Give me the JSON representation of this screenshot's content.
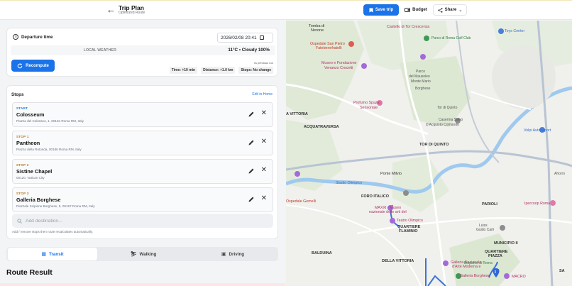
{
  "header": {
    "title": "Trip Plan",
    "subtitle": "Optimized Route",
    "save_label": "Save trip",
    "budget_label": "Budget",
    "share_label": "Share"
  },
  "departure": {
    "label": "Departure time",
    "value": "2026/02/08 20:41"
  },
  "weather": {
    "label": "LOCAL WEATHER",
    "value": "11°C • Cloudy 100%"
  },
  "recompute": {
    "label": "Recompute",
    "vs_label": "vs previous run",
    "chips": [
      "Time: +10 min",
      "Distance: +1.0 km",
      "Stops: No change"
    ]
  },
  "stops": {
    "title": "Stops",
    "edit_link": "Edit in Home",
    "items": [
      {
        "tag": "START",
        "name": "Colosseum",
        "address": "Piazza del Colosseo, 1, 00184 Roma RM, Italy"
      },
      {
        "tag": "STOP 1",
        "name": "Pantheon",
        "address": "Piazza della Rotonda, 00186 Roma RM, Italy"
      },
      {
        "tag": "STOP 2",
        "name": "Sistine Chapel",
        "address": "00120, Vatican City"
      },
      {
        "tag": "STOP 3",
        "name": "Galleria Borghese",
        "address": "Piazzale Scipione Borghese, 5, 00197 Roma RM, Italy"
      }
    ],
    "add_placeholder": "Add destination...",
    "hint": "Add / remove stops then route recalculates automatically."
  },
  "modes": {
    "items": [
      "Transit",
      "Walking",
      "Driving"
    ],
    "active": "Transit"
  },
  "route_result": {
    "title": "Route Result"
  },
  "map": {
    "labels": {
      "tomba_1": "Tomba di",
      "tomba_2": "Nerone",
      "castello": "Castello di Tor Crescenza",
      "parco_golf": "Parco di Roma Golf Club",
      "toys": "Toys Center",
      "ospedale_1": "Ospedale San Pietro",
      "ospedale_2": "Fatebenefratelli",
      "museo_1": "Museo e Fondazione",
      "museo_2": "Venanzo Crocetti",
      "parco_1": "Parco",
      "parco_2": "del Mausoleo",
      "parco_3": "Monte Mario",
      "parco_4": "Tor di Quinto",
      "parco_5": "Borghese",
      "profumo_1": "Profumo Spazio",
      "profumo_2": "Sensoriale",
      "caserma_1": "Caserma Salvo",
      "caserma_2": "D'Acquisto Comando",
      "vittoria": "A VITTORIA",
      "acquatraversa": "ACQUATRAVERSA",
      "tor_di_quinto": "TOR DI QUINTO",
      "ponte_milvio": "Ponte Milvio",
      "stadio": "Stadio Olimpico",
      "foro": "FORO ITALICO",
      "maxxi_1": "MAXXI - Museo",
      "maxxi_2": "nazionale delle arti del",
      "teatro": "Teatro Olimpico",
      "quartiere_1": "QUARTIERE",
      "quartiere_2": "FLAMINIO",
      "gemelli": "Ospedale Gemelli",
      "balduina": "BALDUINA",
      "della_vittoria": "DELLA VITTORIA",
      "galleria_naz_1": "Galleria Nazionale",
      "galleria_naz_2": "d'Arte Moderna e",
      "bioparco": "Bioparco di Roma",
      "galleria_borghese": "Galleria Borghese",
      "parioli": "PARIOLI",
      "municipio": "MUNICIPIO II",
      "q_parioli_1": "QUARTIERE",
      "q_parioli_2": "PIAZZA",
      "ipercoop": "Ipercoop Roma",
      "volpi": "Volpi Autoimport",
      "ahorro": "Ahorro",
      "guido": "Guido Carli",
      "macro": "MACRO",
      "sa": "SA",
      "luiss": "Luiss"
    }
  }
}
